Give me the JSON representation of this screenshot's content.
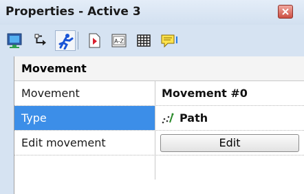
{
  "window": {
    "title": "Properties - Active 3"
  },
  "toolbar": {
    "tabs": [
      {
        "icon": "display-icon"
      },
      {
        "icon": "events-icon"
      },
      {
        "icon": "movement-icon",
        "active": true
      },
      {
        "icon": "runtime-options-icon"
      },
      {
        "icon": "values-icon"
      },
      {
        "icon": "grid-icon"
      },
      {
        "icon": "about-icon"
      }
    ]
  },
  "grid": {
    "section": "Movement",
    "rows": [
      {
        "name": "Movement",
        "value": "Movement #0"
      },
      {
        "name": "Type",
        "value": "Path",
        "value_icon": "path-icon",
        "selected": true
      },
      {
        "name": "Edit movement",
        "button": "Edit"
      }
    ]
  },
  "colors": {
    "panel_bg": "#d6e3f2",
    "selection": "#3c8ee8",
    "close_button": "#cc4f43"
  }
}
